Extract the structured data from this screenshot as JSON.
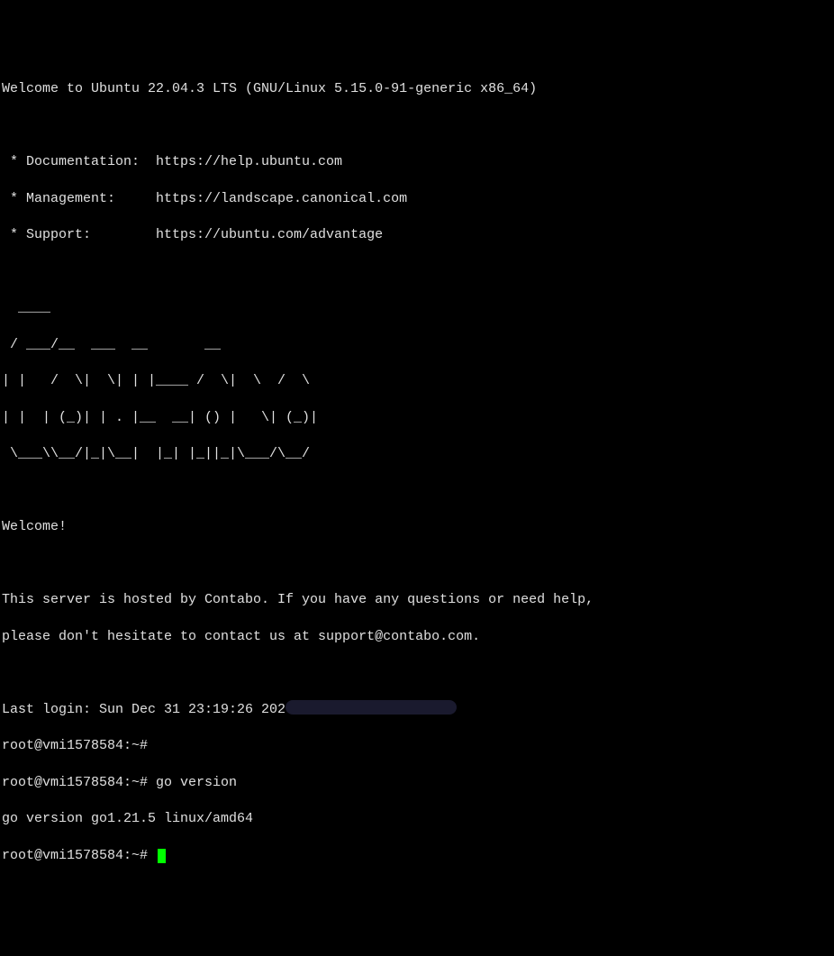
{
  "motd": {
    "welcome_line": "Welcome to Ubuntu 22.04.3 LTS (GNU/Linux 5.15.0-91-generic x86_64)",
    "doc_label": " * Documentation:  https://help.ubuntu.com",
    "mgmt_label": " * Management:     https://landscape.canonical.com",
    "support_label": " * Support:        https://ubuntu.com/advantage",
    "ascii_art_1": "  ____",
    "ascii_art_2": " / ___/__  ___  __       __          ",
    "ascii_art_3": "| |   /  \\|  \\| | |____ /  \\|  \\  /  \\",
    "ascii_art_4": "| |  | (_)| | . |__  __| () |   \\| (_)|",
    "ascii_art_5": " \\___\\\\__/|_|\\__|  |_| |_||_|\\___/\\__/ ",
    "welcome_text": "Welcome!",
    "hosted_text": "This server is hosted by Contabo. If you have any questions or need help,",
    "contact_text": "please don't hesitate to contact us at support@contabo.com.",
    "last_login": "Last login: Sun Dec 31 23:19:26 202"
  },
  "session": {
    "prompt1": "root@vmi1578584:~#",
    "prompt2": "root@vmi1578584:~# ",
    "command1": "go version",
    "output1": "go version go1.21.5 linux/amd64",
    "prompt3": "root@vmi1578584:~# "
  }
}
